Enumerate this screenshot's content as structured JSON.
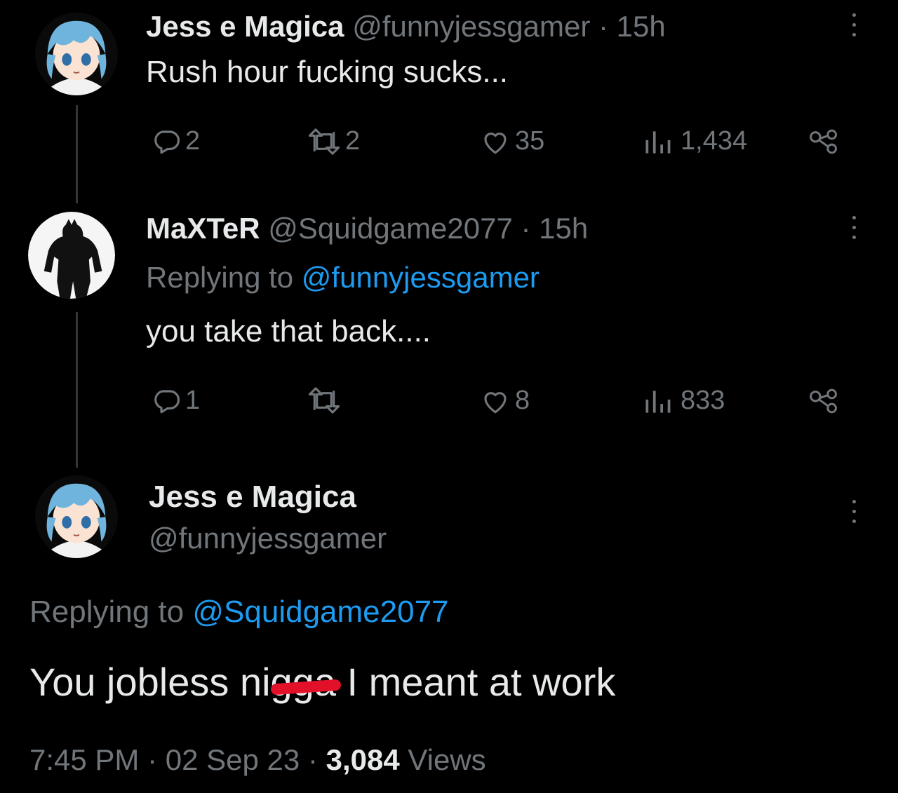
{
  "tweets": [
    {
      "display_name": "Jess e Magica",
      "handle": "@funnyjessgamer",
      "separator": "·",
      "time": "15h",
      "text": "Rush hour fucking sucks...",
      "actions": {
        "replies": "2",
        "retweets": "2",
        "likes": "35",
        "views": "1,434"
      }
    },
    {
      "display_name": "MaXTeR",
      "handle": "@Squidgame2077",
      "separator": "·",
      "time": "15h",
      "replying_prefix": "Replying to",
      "replying_handle": "@funnyjessgamer",
      "text": "you take that back....",
      "actions": {
        "replies": "1",
        "retweets": "",
        "likes": "8",
        "views": "833"
      }
    }
  ],
  "focused": {
    "display_name": "Jess e Magica",
    "handle": "@funnyjessgamer",
    "replying_prefix": "Replying to",
    "replying_handle": "@Squidgame2077",
    "text_before": "You jobless ",
    "text_redacted": "nigga",
    "text_after": " I meant at work",
    "time": "7:45 PM",
    "sep1": "·",
    "date": "02 Sep 23",
    "sep2": "·",
    "views_count": "3,084",
    "views_label": "Views"
  },
  "icons": [
    "reply-icon",
    "retweet-icon",
    "like-icon",
    "views-icon",
    "share-icon",
    "more-icon"
  ],
  "colors": {
    "background": "#000000",
    "text": "#e7e9ea",
    "muted": "#71767b",
    "link": "#1d9bf0",
    "redaction": "#e3102a"
  }
}
